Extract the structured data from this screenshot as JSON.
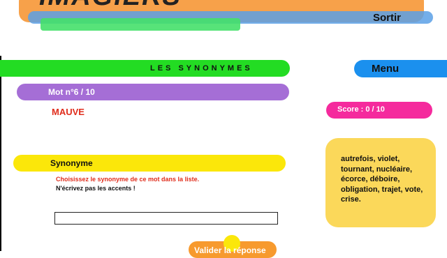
{
  "header": {
    "logo_text": "IMAGIERS",
    "exit_label": "Sortir"
  },
  "section": {
    "title": "LES SYNONYMES"
  },
  "menu": {
    "label": "Menu"
  },
  "question": {
    "word_number_label": "Mot n°6 / 10",
    "word": "MAUVE"
  },
  "score": {
    "label": "Score :  0 / 10"
  },
  "synonym": {
    "header": "Synonyme",
    "instruction": "Choisissez le synonyme de ce mot dans la liste.",
    "note": "N'écrivez pas les accents !"
  },
  "answer": {
    "value": "",
    "placeholder": ""
  },
  "word_list": {
    "text": "autrefois, violet, tournant, nucléaire, écorce, déboire, obligation, trajet, vote, crise."
  },
  "validate": {
    "label": "Valider la réponse"
  },
  "colors": {
    "orange": "#f7a14a",
    "green": "#23dc23",
    "blue": "#1b90ee",
    "purple": "#a56ed6",
    "pink": "#f52a9d",
    "yellow": "#fbe70a",
    "red": "#e02d1c"
  }
}
